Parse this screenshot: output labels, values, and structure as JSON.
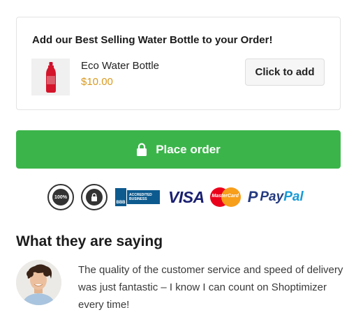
{
  "upsell": {
    "title": "Add our Best Selling Water Bottle to your Order!",
    "product_name": "Eco Water Bottle",
    "product_price": "$10.00",
    "add_button_label": "Click to add",
    "price_color": "#d99a1f"
  },
  "checkout": {
    "place_order_label": "Place order",
    "button_color": "#3bb54a"
  },
  "trust_badges": {
    "satisfaction_seal": "100%",
    "secure_seal_icon": "lock-icon",
    "bbb_text": [
      "ACCREDITED",
      "BUSINESS"
    ],
    "bbb_logo": "BBB",
    "visa": "VISA",
    "mastercard": "MasterCard",
    "paypal_pay": "Pay",
    "paypal_pal": "Pal"
  },
  "testimonial": {
    "heading": "What they are saying",
    "quote": "The quality of the customer service and speed of delivery was just fantastic – I know I can count on Shoptimizer every time!"
  }
}
